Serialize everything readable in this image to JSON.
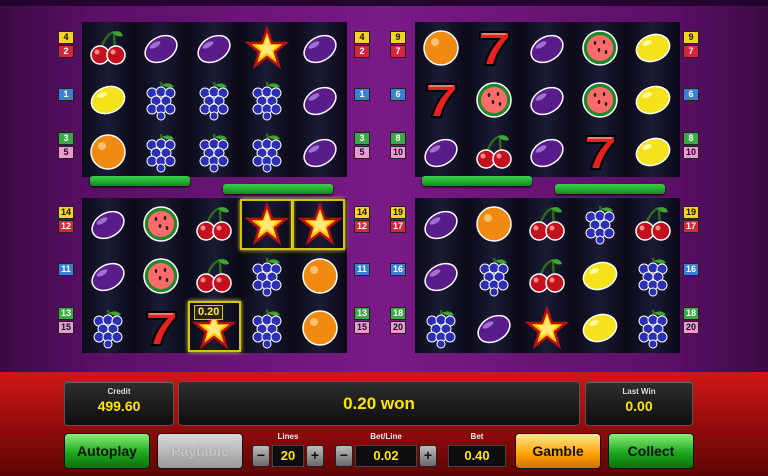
{
  "line_badges": {
    "tl_left": [
      "4",
      "2",
      "1",
      "3",
      "5"
    ],
    "tl_right": [
      "4",
      "2",
      "1",
      "3",
      "5"
    ],
    "tr_left": [
      "9",
      "7",
      "6",
      "8",
      "10"
    ],
    "tr_right": [
      "9",
      "7",
      "6",
      "8",
      "10"
    ],
    "bl_left": [
      "14",
      "12",
      "11",
      "13",
      "15"
    ],
    "bl_right": [
      "14",
      "12",
      "11",
      "13",
      "15"
    ],
    "br_left": [
      "19",
      "17",
      "16",
      "18",
      "20"
    ],
    "br_right": [
      "19",
      "17",
      "16",
      "18",
      "20"
    ]
  },
  "grids": {
    "top_left": [
      [
        "cherry",
        "lemon",
        "orange"
      ],
      [
        "plum",
        "grapes",
        "grapes"
      ],
      [
        "plum",
        "grapes",
        "grapes"
      ],
      [
        "star",
        "grapes",
        "grapes"
      ],
      [
        "plum",
        "plum",
        "plum"
      ]
    ],
    "top_right": [
      [
        "orange",
        "seven",
        "plum"
      ],
      [
        "seven",
        "watermelon",
        "cherry"
      ],
      [
        "plum",
        "plum",
        "plum"
      ],
      [
        "watermelon",
        "watermelon",
        "seven"
      ],
      [
        "lemon",
        "lemon",
        "lemon"
      ]
    ],
    "bottom_left": [
      [
        "plum",
        "plum",
        "grapes"
      ],
      [
        "watermelon",
        "watermelon",
        "seven"
      ],
      [
        "cherry",
        "cherry",
        "star"
      ],
      [
        "star",
        "grapes",
        "grapes"
      ],
      [
        "star",
        "orange",
        "orange"
      ]
    ],
    "bottom_right": [
      [
        "plum",
        "plum",
        "grapes"
      ],
      [
        "orange",
        "grapes",
        "plum"
      ],
      [
        "cherry",
        "cherry",
        "star"
      ],
      [
        "grapes",
        "lemon",
        "lemon"
      ],
      [
        "cherry",
        "grapes",
        "grapes"
      ]
    ]
  },
  "win_highlight_value": "0.20",
  "credit": {
    "label": "Credit",
    "value": "499.60"
  },
  "won_text": "0.20 won",
  "last_win": {
    "label": "Last Win",
    "value": "0.00"
  },
  "buttons": {
    "autoplay": "Autoplay",
    "paytable": "Paytable",
    "gamble": "Gamble",
    "collect": "Collect"
  },
  "lines": {
    "label": "Lines",
    "value": "20"
  },
  "bet_line": {
    "label": "Bet/Line",
    "value": "0.02"
  },
  "bet": {
    "label": "Bet",
    "value": "0.40"
  },
  "stepper": {
    "minus": "−",
    "plus": "+"
  },
  "colors": {
    "accent_yellow": "#ffe600",
    "panel_red": "#d11717",
    "button_green": "#1ea81e",
    "button_orange": "#ffa000"
  }
}
